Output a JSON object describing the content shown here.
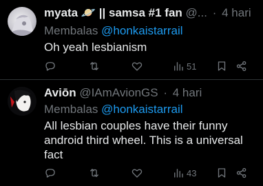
{
  "tweets": [
    {
      "name": "myata",
      "name_suffix": "🪐 || samsa #1 fan",
      "handle": "@...",
      "time": "4 hari",
      "reply_prefix": "Membalas",
      "reply_handle": "@honkaistarrail",
      "text": "Oh yeah lesbianism",
      "views": "51",
      "icons": [
        "reply-icon",
        "retweet-icon",
        "like-icon",
        "views-icon",
        "bookmark-icon",
        "share-icon"
      ]
    },
    {
      "name": "Aviōn",
      "name_suffix": "",
      "handle": "@IAmAvionGS",
      "time": "4 hari",
      "reply_prefix": "Membalas",
      "reply_handle": "@honkaistarrail",
      "text": "All lesbian couples have their funny android third wheel. This is a universal fact",
      "views": "43",
      "icons": [
        "reply-icon",
        "retweet-icon",
        "like-icon",
        "views-icon",
        "bookmark-icon",
        "share-icon"
      ]
    }
  ],
  "colors": {
    "background": "#000000",
    "text": "#e7e9ea",
    "muted": "#71767b",
    "link": "#1d9bf0",
    "divider": "#2f3336"
  }
}
